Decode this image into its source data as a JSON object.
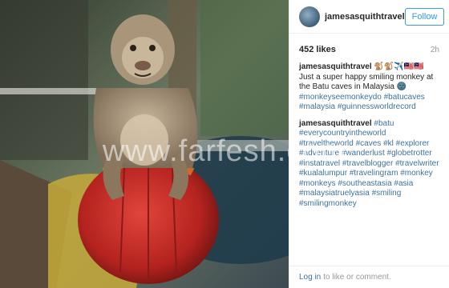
{
  "post": {
    "username": "jamesasquithtravel",
    "follow_label": "Follow",
    "likes": "452 likes",
    "time": "2h"
  },
  "caption": {
    "user": "jamesasquithtravel",
    "emoji_prefix": "🐒🐒✈️🇲🇾🇲🇾",
    "text": "Just a super happy smiling monkey at the Batu caves in Malaysia 🌚",
    "tags": [
      "#monkeyseemonkeydo",
      "#batucaves",
      "#malaysia",
      "#guinnessworldrecord"
    ]
  },
  "comment2": {
    "user": "jamesasquithtravel",
    "tags": [
      "#batu",
      "#everycountryintheworld",
      "#traveltheworld",
      "#caves",
      "#kl",
      "#explorer",
      "#adventure",
      "#wanderlust",
      "#globetrotter",
      "#instatravel",
      "#travelblogger",
      "#travelwriter",
      "#kualalumpur",
      "#travelingram",
      "#monkey",
      "#monkeys",
      "#southeastasia",
      "#asia",
      "#malaysiatruelyasia",
      "#smiling",
      "#smilingmonkey"
    ]
  },
  "footer": {
    "login_label": "Log in",
    "rest_text": "to like or comment."
  },
  "watermark": "www.farfesh.com",
  "icons": [
    "avatar"
  ],
  "colors": {
    "link": "#3f729b",
    "follow": "#3897f0",
    "muted": "#999999"
  }
}
